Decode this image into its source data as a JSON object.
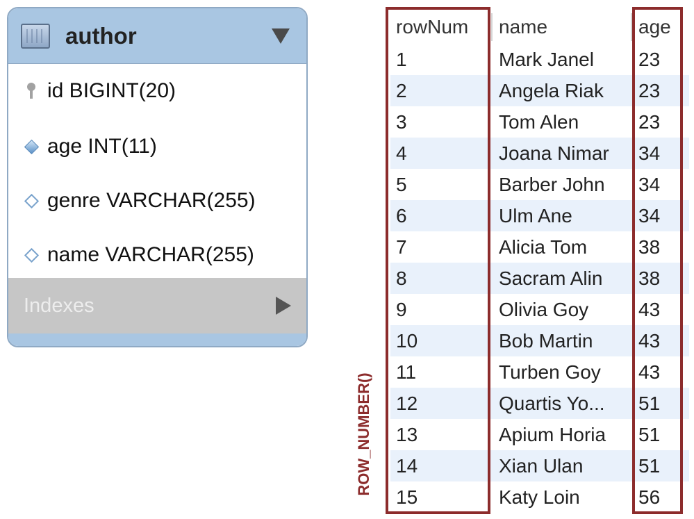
{
  "entity": {
    "title": "author",
    "columns": [
      {
        "label": "id BIGINT(20)",
        "icon": "primary-key-icon"
      },
      {
        "label": "age INT(11)",
        "icon": "filled-diamond-icon"
      },
      {
        "label": "genre VARCHAR(255)",
        "icon": "hollow-diamond-icon"
      },
      {
        "label": "name VARCHAR(255)",
        "icon": "hollow-diamond-icon"
      }
    ],
    "indexes_label": "Indexes",
    "colors": {
      "header": "#a9c6e2",
      "indexes": "#c6c6c6"
    }
  },
  "result": {
    "headers": {
      "rownum": "rowNum",
      "name": "name",
      "age": "age"
    },
    "rows": [
      {
        "rownum": "1",
        "name": "Mark Janel",
        "age": "23"
      },
      {
        "rownum": "2",
        "name": "Angela Riak",
        "age": "23"
      },
      {
        "rownum": "3",
        "name": "Tom Alen",
        "age": "23"
      },
      {
        "rownum": "4",
        "name": "Joana Nimar",
        "age": "34"
      },
      {
        "rownum": "5",
        "name": "Barber John",
        "age": "34"
      },
      {
        "rownum": "6",
        "name": "Ulm Ane",
        "age": "34"
      },
      {
        "rownum": "7",
        "name": "Alicia Tom",
        "age": "38"
      },
      {
        "rownum": "8",
        "name": "Sacram Alin",
        "age": "38"
      },
      {
        "rownum": "9",
        "name": "Olivia Goy",
        "age": "43"
      },
      {
        "rownum": "10",
        "name": "Bob Martin",
        "age": "43"
      },
      {
        "rownum": "11",
        "name": "Turben Goy",
        "age": "43"
      },
      {
        "rownum": "12",
        "name": "Quartis Yo...",
        "age": "51"
      },
      {
        "rownum": "13",
        "name": "Apium Horia",
        "age": "51"
      },
      {
        "rownum": "14",
        "name": "Xian Ulan",
        "age": "51"
      },
      {
        "rownum": "15",
        "name": "Katy Loin",
        "age": "56"
      }
    ],
    "highlight_color": "#8c2c2c",
    "alt_row_color": "#e9f1fb"
  },
  "annotation": {
    "label": "ROW_NUMBER()"
  }
}
